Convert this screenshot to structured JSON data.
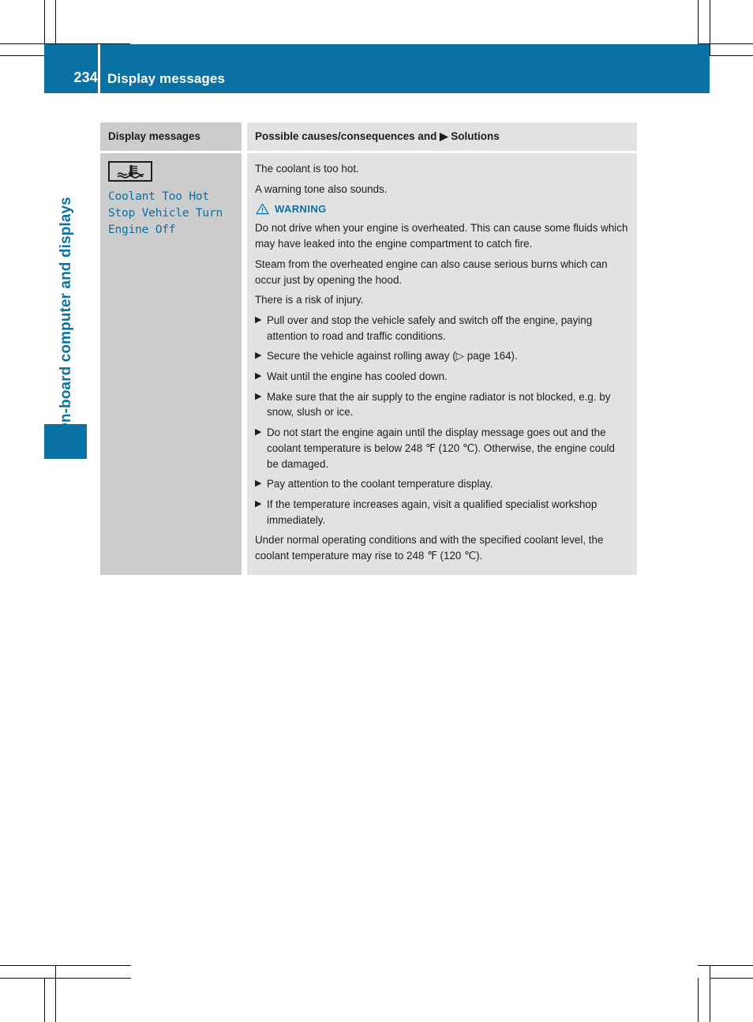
{
  "page": {
    "number": "234",
    "header_title": "Display messages",
    "chapter_label": "On-board computer and displays",
    "accent_color": "#0a71a3"
  },
  "table": {
    "headers": {
      "left": "Display messages",
      "right": "Possible causes/consequences and ▶ Solutions"
    },
    "row": {
      "icon_name": "coolant-temperature-warning-icon",
      "message": "Coolant Too Hot\nStop Vehicle Turn\nEngine Off",
      "intro_1": "The coolant is too hot.",
      "intro_2": "A warning tone also sounds.",
      "warning_label": "WARNING",
      "warning_icon_name": "warning-triangle-icon",
      "warning_paragraphs": [
        "Do not drive when your engine is overheated. This can cause some fluids which may have leaked into the engine compartment to catch fire.",
        "Steam from the overheated engine can also cause serious burns which can occur just by opening the hood.",
        "There is a risk of injury."
      ],
      "bullet_marker": "▶",
      "bullets": [
        "Pull over and stop the vehicle safely and switch off the engine, paying attention to road and traffic conditions.",
        "Secure the vehicle against rolling away (▷ page 164).",
        "Wait until the engine has cooled down.",
        "Make sure that the air supply to the engine radiator is not blocked, e.g. by snow, slush or ice.",
        "Do not start the engine again until the display message goes out and the coolant temperature is below 248 ℉ (120 ℃). Otherwise, the engine could be damaged.",
        "Pay attention to the coolant temperature display.",
        "If the temperature increases again, visit a qualified specialist workshop immediately."
      ],
      "closing": "Under normal operating conditions and with the specified coolant level, the coolant temperature may rise to 248 ℉ (120 ℃)."
    }
  }
}
